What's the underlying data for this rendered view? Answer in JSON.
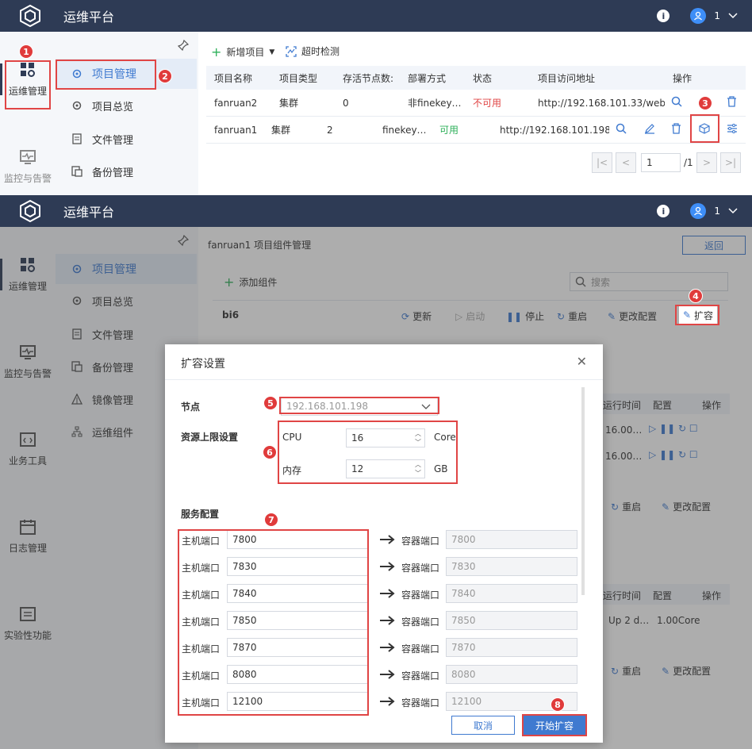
{
  "app": {
    "title": "运维平台",
    "user": "1"
  },
  "left_nav": [
    {
      "label": "运维管理"
    },
    {
      "label": "监控与告警"
    },
    {
      "label": "业务工具"
    },
    {
      "label": "日志管理"
    },
    {
      "label": "实验性功能"
    }
  ],
  "sub_nav": [
    {
      "label": "项目管理"
    },
    {
      "label": "项目总览"
    },
    {
      "label": "文件管理"
    },
    {
      "label": "备份管理"
    },
    {
      "label": "镜像管理"
    },
    {
      "label": "运维组件"
    }
  ],
  "toolbar": {
    "new_project": "新增项目",
    "timeout_check": "超时检测"
  },
  "table": {
    "headers": [
      "项目名称",
      "项目类型",
      "存活节点数:",
      "部署方式",
      "状态",
      "项目访问地址",
      "操作"
    ],
    "rows": [
      {
        "name": "fanruan2",
        "type": "集群",
        "nodes": "0",
        "deploy": "非finekey…",
        "status": "不可用",
        "url": "http://192.168.101.33/webr…"
      },
      {
        "name": "fanruan1",
        "type": "集群",
        "nodes": "2",
        "deploy": "finekey…",
        "status": "可用",
        "url": "http://192.168.101.198:…"
      }
    ]
  },
  "pager": {
    "page": "1",
    "total": "/1"
  },
  "component_page": {
    "title": "fanruan1 项目组件管理",
    "back": "返回",
    "add_component": "添加组件",
    "search_placeholder": "搜索",
    "component_name": "bi6",
    "actions": [
      "更新",
      "启动",
      "停止",
      "重启",
      "更改配置",
      "扩容"
    ],
    "bg_headers": [
      "运行时间",
      "配置",
      "操作"
    ],
    "bg_rows": [
      "16.00…",
      "16.00…"
    ],
    "bg_row2": {
      "runtime": "Up 2 d…",
      "config": "1.00Core"
    },
    "bg_actions": [
      "重启",
      "更改配置"
    ]
  },
  "dialog": {
    "title": "扩容设置",
    "node_label": "节点",
    "node_value": "192.168.101.198",
    "resource_label": "资源上限设置",
    "cpu_label": "CPU",
    "cpu_value": "16",
    "cpu_unit": "Core",
    "mem_label": "内存",
    "mem_value": "12",
    "mem_unit": "GB",
    "service_label": "服务配置",
    "host_port_label": "主机端口",
    "container_port_label": "容器端口",
    "ports": [
      "7800",
      "7830",
      "7840",
      "7850",
      "7870",
      "8080",
      "12100"
    ],
    "cancel": "取消",
    "confirm": "开始扩容"
  },
  "badges": [
    "1",
    "2",
    "3",
    "4",
    "5",
    "6",
    "7",
    "8"
  ],
  "colors": {
    "header": "#2e3b55",
    "accent": "#3f7ad0",
    "annotation": "#e04545",
    "ok": "#2eb05a"
  }
}
